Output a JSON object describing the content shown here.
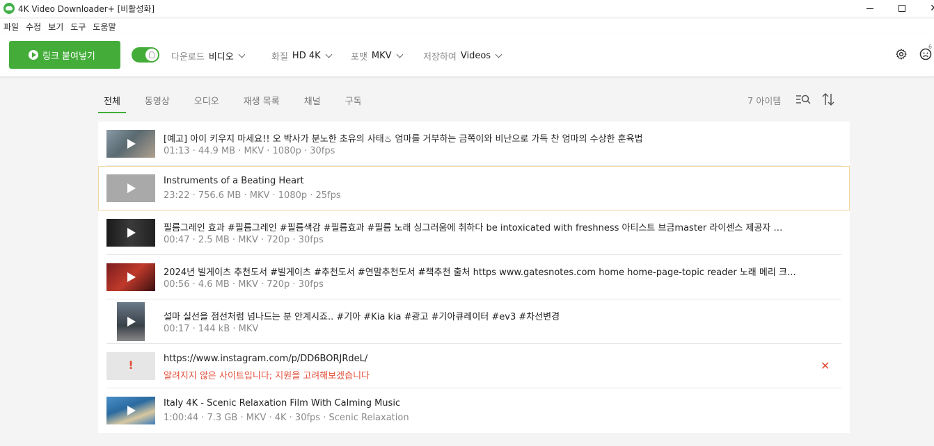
{
  "window": {
    "title": "4K Video Downloader+ [비활성화]"
  },
  "menu": [
    "파일",
    "수정",
    "보기",
    "도구",
    "도움말"
  ],
  "toolbar": {
    "paste_label": "링크 붙여넣기",
    "download_label": "다운로드",
    "download_value": "비디오",
    "quality_label": "화질",
    "quality_value": "HD 4K",
    "format_label": "포맷",
    "format_value": "MKV",
    "save_label": "저장하여",
    "save_value": "Videos",
    "badge": "6"
  },
  "tabs": [
    "전체",
    "동영상",
    "오디오",
    "재생 목록",
    "채널",
    "구독"
  ],
  "item_count": "7 아이템",
  "items": [
    {
      "title": "[예고] 아이 키우지 마세요!! 오 박사가 분노한 초유의 사태♨ 엄마를 거부하는 금쪽이와 비난으로 가득 찬 엄마의 수상한 훈육법",
      "meta": "01:13 · 44.9 MB · MKV · 1080p · 30fps"
    },
    {
      "title": "Instruments of a Beating Heart",
      "meta": "23:22 · 756.6 MB · MKV · 1080p · 25fps"
    },
    {
      "title": "필름그레인 효과  #필름그레인 #필름색감 #필름효과 #필름 노래  싱그러움에 취하다 be intoxicated with freshness 아티스트  브금master 라이센스 제공자 …",
      "meta": "00:47 · 2.5 MB · MKV · 720p · 30fps"
    },
    {
      "title": "2024년 빌게이츠 추천도서  #빌게이츠 #추천도서 #연말추천도서 #책추천  출처  https www.gatesnotes.com home home-page-topic reader  노래  메리 크…",
      "meta": "00:56 · 4.6 MB · MKV · 720p · 30fps"
    },
    {
      "title": "설마 실선을 점선처럼 넘나드는 분 안계시죠..                        #기아 #Kia kia #광고 #기아큐레이터 #ev3 #차선변경",
      "meta": "00:17 · 144 kB · MKV"
    },
    {
      "title": "https://www.instagram.com/p/DD6BORJRdeL/",
      "meta": "알려지지 않은 사이트입니다; 지원을 고려해보겠습니다"
    },
    {
      "title": "Italy 4K - Scenic Relaxation Film With Calming Music",
      "meta": "1:00:44 · 7.3 GB · MKV · 4K · 30fps · Scenic Relaxation"
    }
  ],
  "colors": {
    "accent": "#44ad3a",
    "error": "#e24f3a"
  }
}
